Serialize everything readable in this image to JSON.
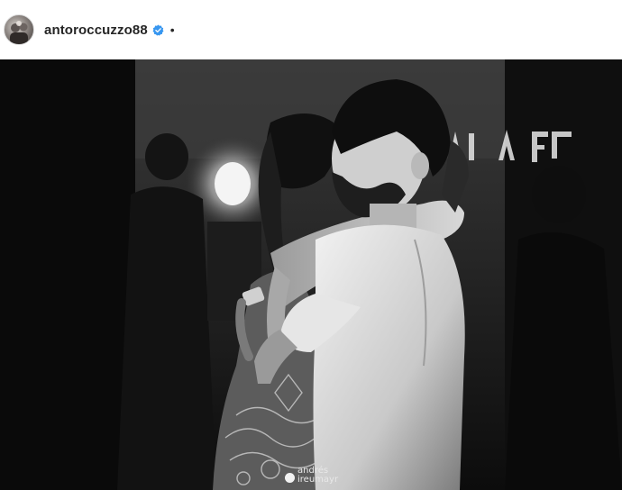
{
  "post": {
    "username": "antoroccuzzo88",
    "separator": "•",
    "verified_icon": "verified-badge-icon",
    "verified_color": "#3897f0"
  },
  "photo": {
    "watermark_line1": "andrés",
    "watermark_line2": "ireumayr",
    "tone": "black-and-white"
  }
}
